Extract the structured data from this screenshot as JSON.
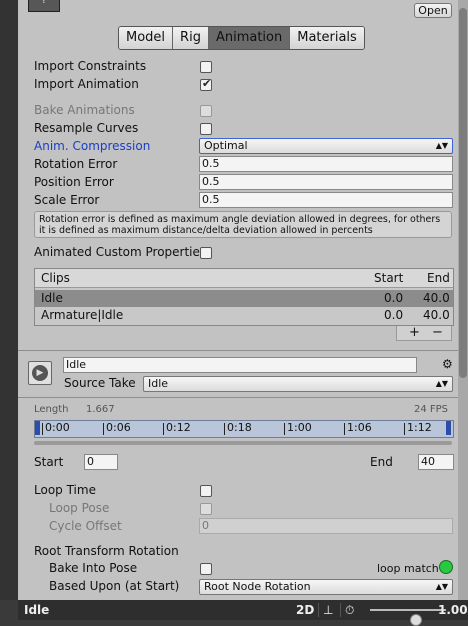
{
  "header": {
    "object_icon": "?",
    "open_label": "Open"
  },
  "tabs": [
    "Model",
    "Rig",
    "Animation",
    "Materials"
  ],
  "active_tab": "Animation",
  "settings": {
    "import_constraints": {
      "label": "Import Constraints",
      "checked": false
    },
    "import_animation": {
      "label": "Import Animation",
      "checked": true
    },
    "bake_animations": {
      "label": "Bake Animations",
      "checked": false,
      "disabled": true
    },
    "resample_curves": {
      "label": "Resample Curves",
      "checked": false
    },
    "anim_compression": {
      "label": "Anim. Compression",
      "value": "Optimal"
    },
    "rotation_error": {
      "label": "Rotation Error",
      "value": "0.5"
    },
    "position_error": {
      "label": "Position Error",
      "value": "0.5"
    },
    "scale_error": {
      "label": "Scale Error",
      "value": "0.5"
    },
    "help_text": "Rotation error is defined as maximum angle deviation allowed in degrees, for others it is defined as maximum distance/delta deviation allowed in percents",
    "animated_custom_properties": {
      "label": "Animated Custom Properties",
      "checked": false
    }
  },
  "clips": {
    "headers": {
      "name": "Clips",
      "start": "Start",
      "end": "End"
    },
    "rows": [
      {
        "name": "Idle",
        "start": "0.0",
        "end": "40.0",
        "selected": true
      },
      {
        "name": "Armature|Idle",
        "start": "0.0",
        "end": "40.0",
        "selected": false
      }
    ],
    "add_label": "+",
    "remove_label": "−"
  },
  "clip_editor": {
    "name_value": "Idle",
    "source_take_label": "Source Take",
    "source_take_value": "Idle",
    "length_label": "Length",
    "length_value": "1.667",
    "fps": "24 FPS",
    "timeline_ticks": [
      "0:00",
      "0:06",
      "0:12",
      "0:18",
      "1:00",
      "1:06",
      "1:12"
    ],
    "start_label": "Start",
    "start_value": "0",
    "end_label": "End",
    "end_value": "40",
    "loop_time": {
      "label": "Loop Time",
      "checked": false
    },
    "loop_pose": {
      "label": "Loop Pose",
      "checked": false,
      "disabled": true
    },
    "cycle_offset": {
      "label": "Cycle Offset",
      "value": "0",
      "disabled": true
    },
    "root_transform_rotation": "Root Transform Rotation",
    "bake_into_pose": {
      "label": "Bake Into Pose",
      "checked": false
    },
    "loop_match_label": "loop match",
    "based_upon": {
      "label": "Based Upon (at Start)",
      "value": "Root Node Rotation"
    }
  },
  "statusbar": {
    "clip_name": "Idle",
    "mode_2d": "2D",
    "speed_value": "1.00",
    "slider_fraction": 0.6
  },
  "colors": {
    "panel_bg": "#c2c2c2",
    "accent_blue": "#1a3fc8",
    "loop_match_green": "#27c93f",
    "selected_row": "#8c8c8c"
  }
}
